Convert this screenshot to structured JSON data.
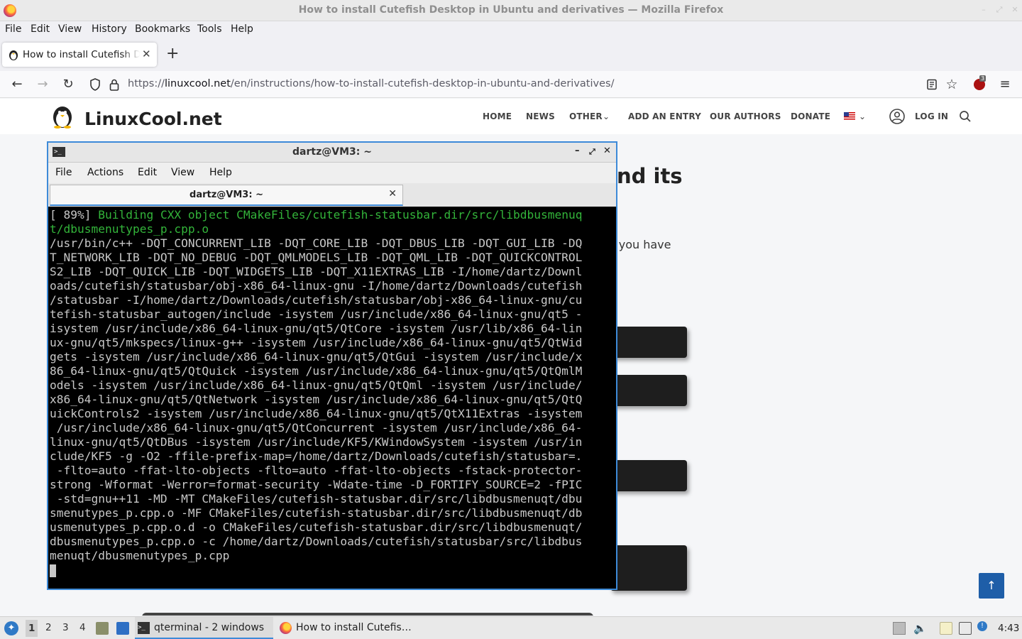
{
  "browser": {
    "window_title": "How to install Cutefish Desktop in Ubuntu and derivatives — Mozilla Firefox",
    "menu": [
      "File",
      "Edit",
      "View",
      "History",
      "Bookmarks",
      "Tools",
      "Help"
    ],
    "tab_title": "How to install Cutefish Desktop in Ubuntu and derivatives",
    "url_prefix": "https://",
    "url_domain": "linuxcool.net",
    "url_path": "/en/instructions/how-to-install-cutefish-desktop-in-ubuntu-and-derivatives/",
    "extension_badge": "3"
  },
  "site": {
    "name": "LinuxCool.net",
    "nav": [
      "HOME",
      "NEWS",
      "OTHER",
      "ADD AN ENTRY",
      "OUR AUTHORS",
      "DONATE",
      "LOG IN"
    ],
    "title_fragment": "nd its",
    "text_fragment": "f you have",
    "scroll_top": "↑"
  },
  "terminal": {
    "title": "dartz@VM3: ~",
    "menu": [
      "File",
      "Actions",
      "Edit",
      "View",
      "Help"
    ],
    "tab_label": "dartz@VM3: ~",
    "progress": "[ 89%] ",
    "status_line1": "Building CXX object CMakeFiles/cutefish-statusbar.dir/src/libdbusmenuq",
    "status_line2": "t/dbusmenutypes_p.cpp.o",
    "output": [
      "/usr/bin/c++ -DQT_CONCURRENT_LIB -DQT_CORE_LIB -DQT_DBUS_LIB -DQT_GUI_LIB -DQ",
      "T_NETWORK_LIB -DQT_NO_DEBUG -DQT_QMLMODELS_LIB -DQT_QML_LIB -DQT_QUICKCONTROL",
      "S2_LIB -DQT_QUICK_LIB -DQT_WIDGETS_LIB -DQT_X11EXTRAS_LIB -I/home/dartz/Downl",
      "oads/cutefish/statusbar/obj-x86_64-linux-gnu -I/home/dartz/Downloads/cutefish",
      "/statusbar -I/home/dartz/Downloads/cutefish/statusbar/obj-x86_64-linux-gnu/cu",
      "tefish-statusbar_autogen/include -isystem /usr/include/x86_64-linux-gnu/qt5 -",
      "isystem /usr/include/x86_64-linux-gnu/qt5/QtCore -isystem /usr/lib/x86_64-lin",
      "ux-gnu/qt5/mkspecs/linux-g++ -isystem /usr/include/x86_64-linux-gnu/qt5/QtWid",
      "gets -isystem /usr/include/x86_64-linux-gnu/qt5/QtGui -isystem /usr/include/x",
      "86_64-linux-gnu/qt5/QtQuick -isystem /usr/include/x86_64-linux-gnu/qt5/QtQmlM",
      "odels -isystem /usr/include/x86_64-linux-gnu/qt5/QtQml -isystem /usr/include/",
      "x86_64-linux-gnu/qt5/QtNetwork -isystem /usr/include/x86_64-linux-gnu/qt5/QtQ",
      "uickControls2 -isystem /usr/include/x86_64-linux-gnu/qt5/QtX11Extras -isystem",
      " /usr/include/x86_64-linux-gnu/qt5/QtConcurrent -isystem /usr/include/x86_64-",
      "linux-gnu/qt5/QtDBus -isystem /usr/include/KF5/KWindowSystem -isystem /usr/in",
      "clude/KF5 -g -O2 -ffile-prefix-map=/home/dartz/Downloads/cutefish/statusbar=.",
      " -flto=auto -ffat-lto-objects -flto=auto -ffat-lto-objects -fstack-protector-",
      "strong -Wformat -Werror=format-security -Wdate-time -D_FORTIFY_SOURCE=2 -fPIC",
      " -std=gnu++11 -MD -MT CMakeFiles/cutefish-statusbar.dir/src/libdbusmenuqt/dbu",
      "smenutypes_p.cpp.o -MF CMakeFiles/cutefish-statusbar.dir/src/libdbusmenuqt/db",
      "usmenutypes_p.cpp.o.d -o CMakeFiles/cutefish-statusbar.dir/src/libdbusmenuqt/",
      "dbusmenutypes_p.cpp.o -c /home/dartz/Downloads/cutefish/statusbar/src/libdbus",
      "menuqt/dbusmenutypes_p.cpp"
    ]
  },
  "taskbar": {
    "workspaces": [
      "1",
      "2",
      "3",
      "4"
    ],
    "active_workspace": "1",
    "tasks": [
      "qterminal - 2 windows",
      "How to install Cutefis…"
    ],
    "clock": "4:43"
  }
}
